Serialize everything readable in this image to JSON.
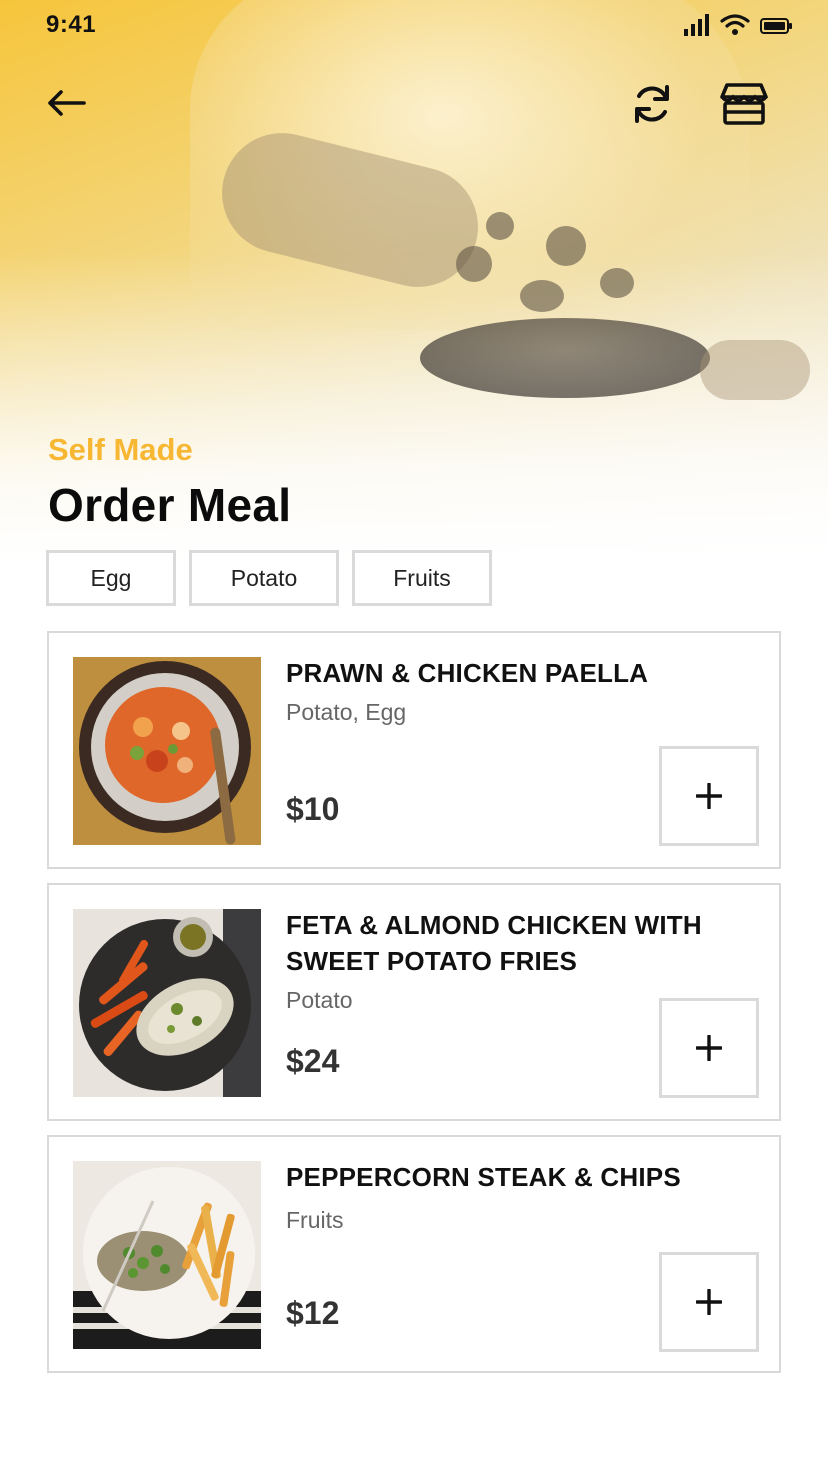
{
  "status_bar": {
    "time": "9:41"
  },
  "header": {
    "subtitle": "Self Made",
    "title": "Order Meal"
  },
  "icons": {
    "back": "arrow-left-icon",
    "refresh": "refresh-icon",
    "store": "store-icon"
  },
  "filters": [
    "Egg",
    "Potato",
    "Fruits"
  ],
  "meals": [
    {
      "name": "PRAWN & CHICKEN PAELLA",
      "tags": "Potato, Egg",
      "price": "$10",
      "add_label": "+"
    },
    {
      "name": "FETA & ALMOND CHICKEN WITH SWEET POTATO FRIES",
      "tags": "Potato",
      "price": "$24",
      "add_label": "+"
    },
    {
      "name": "PEPPERCORN STEAK & CHIPS",
      "tags": "Fruits",
      "price": "$12",
      "add_label": "+"
    }
  ],
  "colors": {
    "accent": "#f7b733",
    "title": "#0b0b0b",
    "border": "#d9d9d9",
    "muted": "#666666"
  }
}
